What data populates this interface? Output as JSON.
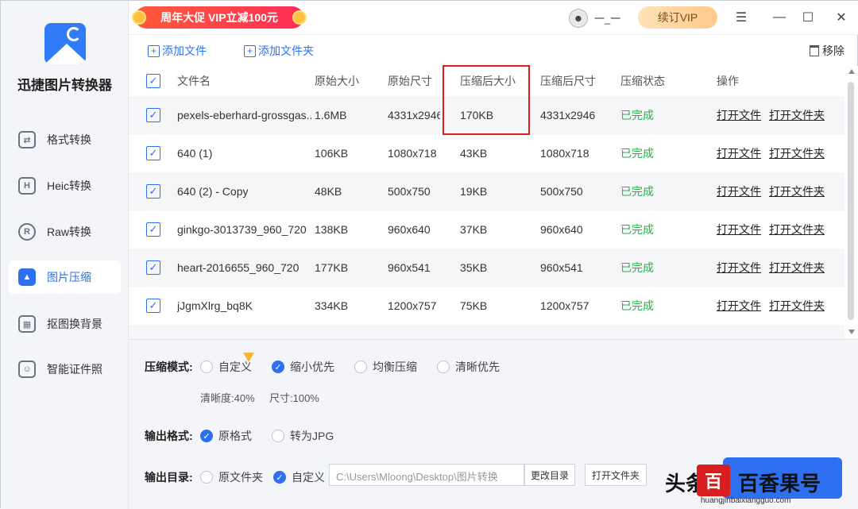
{
  "app": {
    "name": "迅捷图片转换器"
  },
  "sidebar": {
    "items": [
      {
        "label": "格式转换",
        "icon": "format-convert-icon",
        "active": false
      },
      {
        "label": "Heic转换",
        "icon": "heic-icon",
        "active": false
      },
      {
        "label": "Raw转换",
        "icon": "raw-icon",
        "active": false
      },
      {
        "label": "图片压缩",
        "icon": "image-compress-icon",
        "active": true
      },
      {
        "label": "抠图换背景",
        "icon": "cutout-icon",
        "active": false
      },
      {
        "label": "智能证件照",
        "icon": "id-photo-icon",
        "active": false
      }
    ]
  },
  "titlebar": {
    "promo": "周年大促 VIP立减100元",
    "username": "一_一",
    "vip_button": "续订VIP",
    "menu_icon": "☰",
    "minimize_icon": "—",
    "maximize_icon": "☐",
    "close_icon": "✕"
  },
  "toolbar": {
    "add_file": "添加文件",
    "add_folder": "添加文件夹",
    "remove": "移除"
  },
  "table": {
    "headers": [
      "文件名",
      "原始大小",
      "原始尺寸",
      "压缩后大小",
      "压缩后尺寸",
      "压缩状态",
      "操作"
    ],
    "rows": [
      {
        "name": "pexels-eberhard-grossgas...",
        "orig_size": "1.6MB",
        "orig_dim": "4331x2946",
        "new_size": "170KB",
        "new_dim": "4331x2946",
        "status": "已完成",
        "op1": "打开文件",
        "op2": "打开文件夹"
      },
      {
        "name": "640 (1)",
        "orig_size": "106KB",
        "orig_dim": "1080x718",
        "new_size": "43KB",
        "new_dim": "1080x718",
        "status": "已完成",
        "op1": "打开文件",
        "op2": "打开文件夹"
      },
      {
        "name": "640 (2) - Copy",
        "orig_size": "48KB",
        "orig_dim": "500x750",
        "new_size": "19KB",
        "new_dim": "500x750",
        "status": "已完成",
        "op1": "打开文件",
        "op2": "打开文件夹"
      },
      {
        "name": "ginkgo-3013739_960_720",
        "orig_size": "138KB",
        "orig_dim": "960x640",
        "new_size": "37KB",
        "new_dim": "960x640",
        "status": "已完成",
        "op1": "打开文件",
        "op2": "打开文件夹"
      },
      {
        "name": "heart-2016655_960_720",
        "orig_size": "177KB",
        "orig_dim": "960x541",
        "new_size": "35KB",
        "new_dim": "960x541",
        "status": "已完成",
        "op1": "打开文件",
        "op2": "打开文件夹"
      },
      {
        "name": "jJgmXlrg_bq8K",
        "orig_size": "334KB",
        "orig_dim": "1200x757",
        "new_size": "75KB",
        "new_dim": "1200x757",
        "status": "已完成",
        "op1": "打开文件",
        "op2": "打开文件夹"
      }
    ]
  },
  "settings": {
    "mode_label": "压缩模式:",
    "mode_options": [
      "自定义",
      "缩小优先",
      "均衡压缩",
      "清晰优先"
    ],
    "mode_selected": "缩小优先",
    "clarity": "清晰度:40%",
    "size": "尺寸:100%",
    "format_label": "输出格式:",
    "format_options": [
      "原格式",
      "转为JPG"
    ],
    "format_selected": "原格式",
    "output_label": "输出目录:",
    "output_options": [
      "原文件夹",
      "自定义"
    ],
    "output_selected": "自定义",
    "output_path": "C:\\Users\\Mloong\\Desktop\\图片转换",
    "change_dir": "更改目录",
    "open_folder": "打开文件夹"
  },
  "watermark": {
    "left_text": "头条",
    "logo_text": "百",
    "brand": "百香果号",
    "url": "huangjinbaixiangguo.com"
  },
  "colors": {
    "accent": "#2f6ff2",
    "success": "#22b04c",
    "highlight": "#d81e1e"
  }
}
